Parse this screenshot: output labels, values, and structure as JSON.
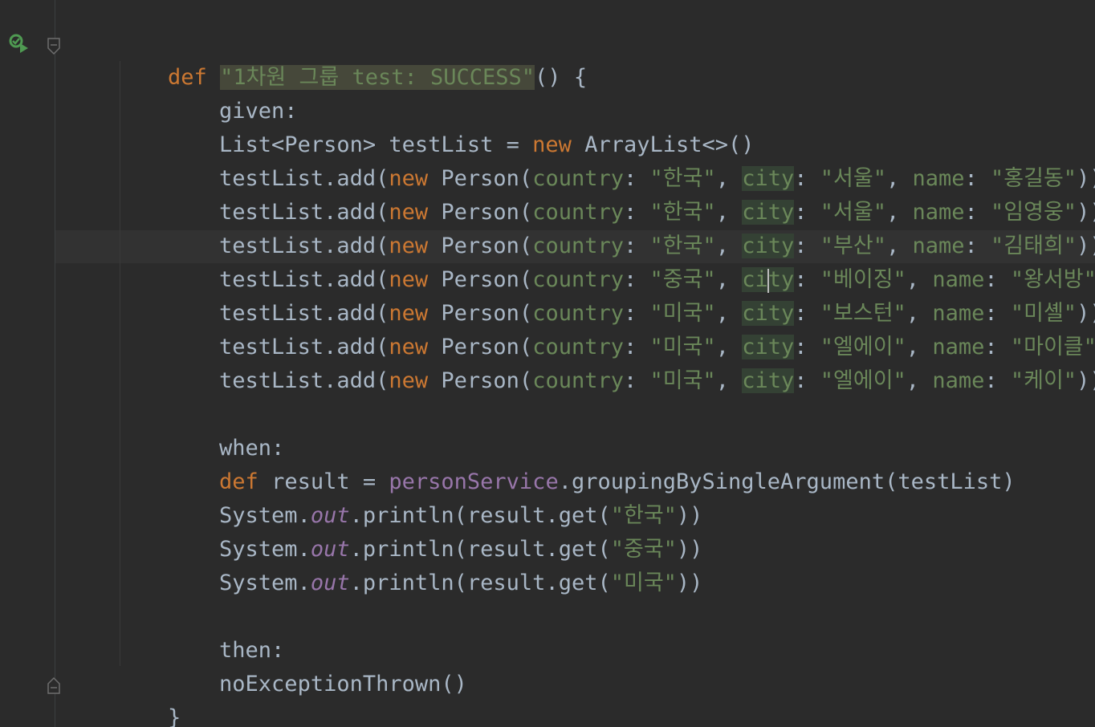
{
  "editor": {
    "lines": {
      "l1": {
        "def": "def",
        "name": "\"1차원 그룹 test: SUCCESS\"",
        "rest": "() {"
      },
      "l2": {
        "text": "given:"
      },
      "l3": {
        "a": "List<Person> testList = ",
        "kw": "new",
        "b": " ArrayList<>()"
      },
      "rows": [
        {
          "country": "\"한국\"",
          "city": "\"서울\"",
          "name": "\"홍길동\""
        },
        {
          "country": "\"한국\"",
          "city": "\"서울\"",
          "name": "\"임영웅\""
        },
        {
          "country": "\"한국\"",
          "city": "\"부산\"",
          "name": "\"김태희\""
        },
        {
          "country": "\"중국\"",
          "city": "\"베이징\"",
          "name": "\"왕서방\""
        },
        {
          "country": "\"미국\"",
          "city": "\"보스턴\"",
          "name": "\"미셸\""
        },
        {
          "country": "\"미국\"",
          "city": "\"엘에이\"",
          "name": "\"마이클\""
        },
        {
          "country": "\"미국\"",
          "city": "\"엘에이\"",
          "name": "\"케이\""
        }
      ],
      "row_tokens": {
        "prefix": "testList.add(",
        "new": "new",
        "person": " Person(",
        "country_label": "country",
        "city_label": "city",
        "city_label_a": "ci",
        "city_label_b": "ty",
        "name_label": "name",
        "colon": ": ",
        "comma": ", ",
        "close": "))"
      },
      "when": {
        "text": "when:"
      },
      "result": {
        "def": "def",
        "a": " result = ",
        "service": "personService",
        "b": ".groupingBySingleArgument(testList)"
      },
      "prints": [
        {
          "sys": "System.",
          "out": "out",
          "a": ".println(result.get(",
          "key": "\"한국\"",
          "b": "))"
        },
        {
          "sys": "System.",
          "out": "out",
          "a": ".println(result.get(",
          "key": "\"중국\"",
          "b": "))"
        },
        {
          "sys": "System.",
          "out": "out",
          "a": ".println(result.get(",
          "key": "\"미국\"",
          "b": "))"
        }
      ],
      "then": {
        "text": "then:"
      },
      "thrown": {
        "text": "noExceptionThrown()"
      },
      "closing": {
        "text": "}"
      }
    },
    "colors": {
      "background": "#2b2b2b",
      "keyword": "#cc7832",
      "string": "#6a8759",
      "field": "#9876aa",
      "text": "#a9b7c6"
    },
    "icons": {
      "run_test": "run-test-passed-icon",
      "fold_start": "fold-start-icon",
      "fold_end": "fold-end-icon"
    }
  }
}
